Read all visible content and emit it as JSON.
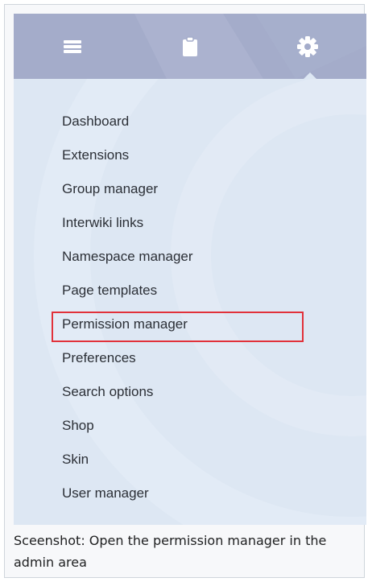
{
  "tabs": [
    {
      "icon": "menu-icon"
    },
    {
      "icon": "clipboard-icon"
    },
    {
      "icon": "gear-icon",
      "active": true
    }
  ],
  "admin_menu": {
    "items": [
      "Dashboard",
      "Extensions",
      "Group manager",
      "Interwiki links",
      "Namespace manager",
      "Page templates",
      "Permission manager",
      "Preferences",
      "Search options",
      "Shop",
      "Skin",
      "User manager"
    ],
    "highlighted_item": "Permission manager"
  },
  "caption": {
    "text": "Sceenshot: Open the permission manager in the admin area"
  },
  "colors": {
    "tabbar": "#a4acca",
    "panel": "#dde7f3",
    "highlight_border": "#e1313a",
    "icon": "#ffffff",
    "text": "#2b2f36"
  }
}
